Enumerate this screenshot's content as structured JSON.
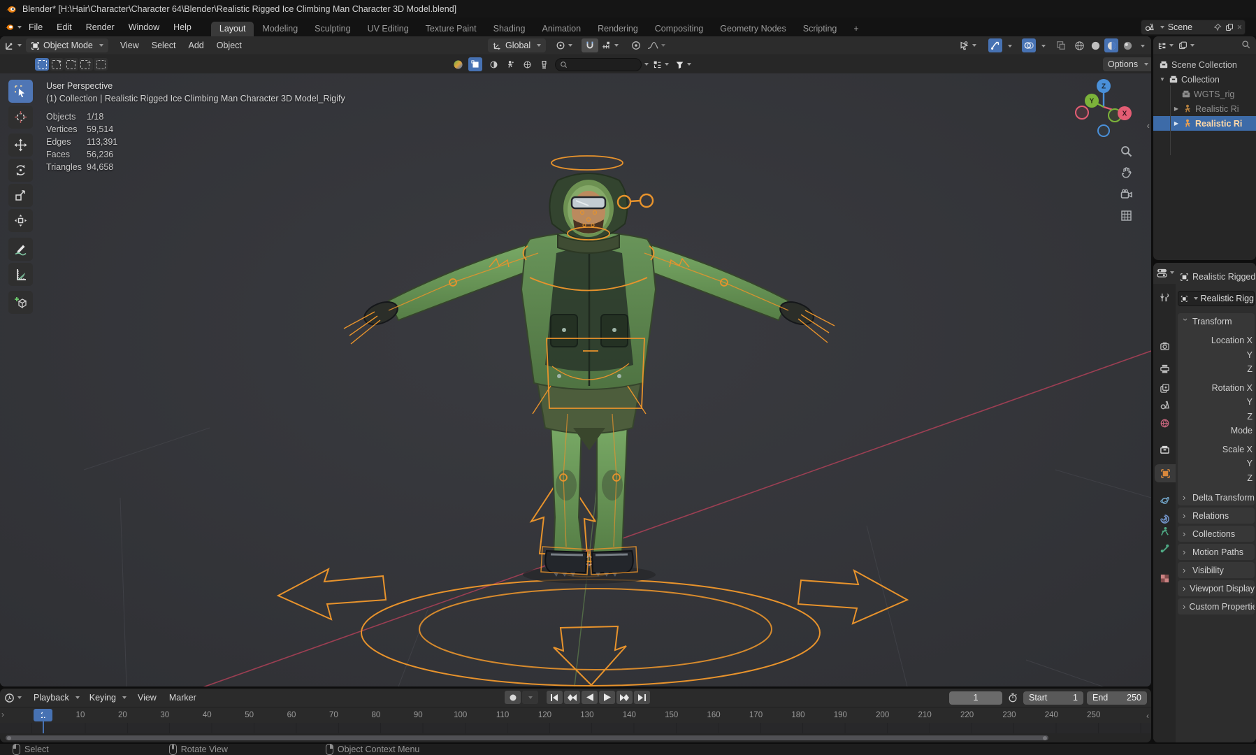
{
  "window": {
    "title": "Blender* [H:\\Hair\\Character\\Character 64\\Blender\\Realistic Rigged Ice Climbing Man Character 3D Model.blend]"
  },
  "topbar": {
    "menus": [
      "File",
      "Edit",
      "Render",
      "Window",
      "Help"
    ],
    "workspaces": [
      "Layout",
      "Modeling",
      "Sculpting",
      "UV Editing",
      "Texture Paint",
      "Shading",
      "Animation",
      "Rendering",
      "Compositing",
      "Geometry Nodes",
      "Scripting"
    ],
    "active_workspace": "Layout",
    "add_workspace": "+",
    "scene_selector": {
      "value": "Scene"
    }
  },
  "viewport": {
    "header": {
      "mode": "Object Mode",
      "menu_view": "View",
      "menu_select": "Select",
      "menu_add": "Add",
      "menu_object": "Object",
      "orientation": "Global",
      "options": "Options"
    },
    "overlay": {
      "view_label": "User Perspective",
      "context_label": "(1) Collection | Realistic Rigged Ice Climbing Man Character 3D Model_Rigify",
      "stats": [
        {
          "label": "Objects",
          "value": "1/18"
        },
        {
          "label": "Vertices",
          "value": "59,514"
        },
        {
          "label": "Edges",
          "value": "113,391"
        },
        {
          "label": "Faces",
          "value": "56,236"
        },
        {
          "label": "Triangles",
          "value": "94,658"
        }
      ]
    },
    "gizmo": {
      "x": "X",
      "y": "Y",
      "z": "Z"
    }
  },
  "outliner": {
    "items": [
      {
        "label": "Scene Collection"
      },
      {
        "label": "Collection"
      },
      {
        "label": "WGTS_rig"
      },
      {
        "label": "Realistic Ri"
      },
      {
        "label": "Realistic Ri"
      }
    ]
  },
  "properties": {
    "breadcrumb": "Realistic Rigged",
    "name_value": "Realistic Rigg",
    "transform_panel": "Transform",
    "transform_rows": [
      "Location X",
      "Y",
      "Z",
      "Rotation X",
      "Y",
      "Z",
      "Mode",
      "Scale X",
      "Y",
      "Z"
    ],
    "subpanel_delta": "Delta Transform",
    "panels": [
      "Relations",
      "Collections",
      "Motion Paths",
      "Visibility",
      "Viewport Display",
      "Custom Properties"
    ]
  },
  "timeline": {
    "menus": [
      "Playback",
      "Keying",
      "View",
      "Marker"
    ],
    "current_frame": "1",
    "start_label": "Start",
    "start_value": "1",
    "end_label": "End",
    "end_value": "250",
    "ruler": [
      "10",
      "20",
      "30",
      "40",
      "50",
      "60",
      "70",
      "80",
      "90",
      "100",
      "110",
      "120",
      "130",
      "140",
      "150",
      "160",
      "170",
      "180",
      "190",
      "200",
      "210",
      "220",
      "230",
      "240",
      "250"
    ]
  },
  "status_bar": {
    "items": [
      {
        "label": "Select"
      },
      {
        "label": "Rotate View"
      },
      {
        "label": "Object Context Menu"
      }
    ]
  },
  "colors": {
    "accent_blue": "#4772b3",
    "selection_blue": "#3d6ba8",
    "object_orange": "#e8932c",
    "axis_x": "#e35d74",
    "axis_y": "#7bb33a",
    "axis_z": "#4a90d9"
  }
}
